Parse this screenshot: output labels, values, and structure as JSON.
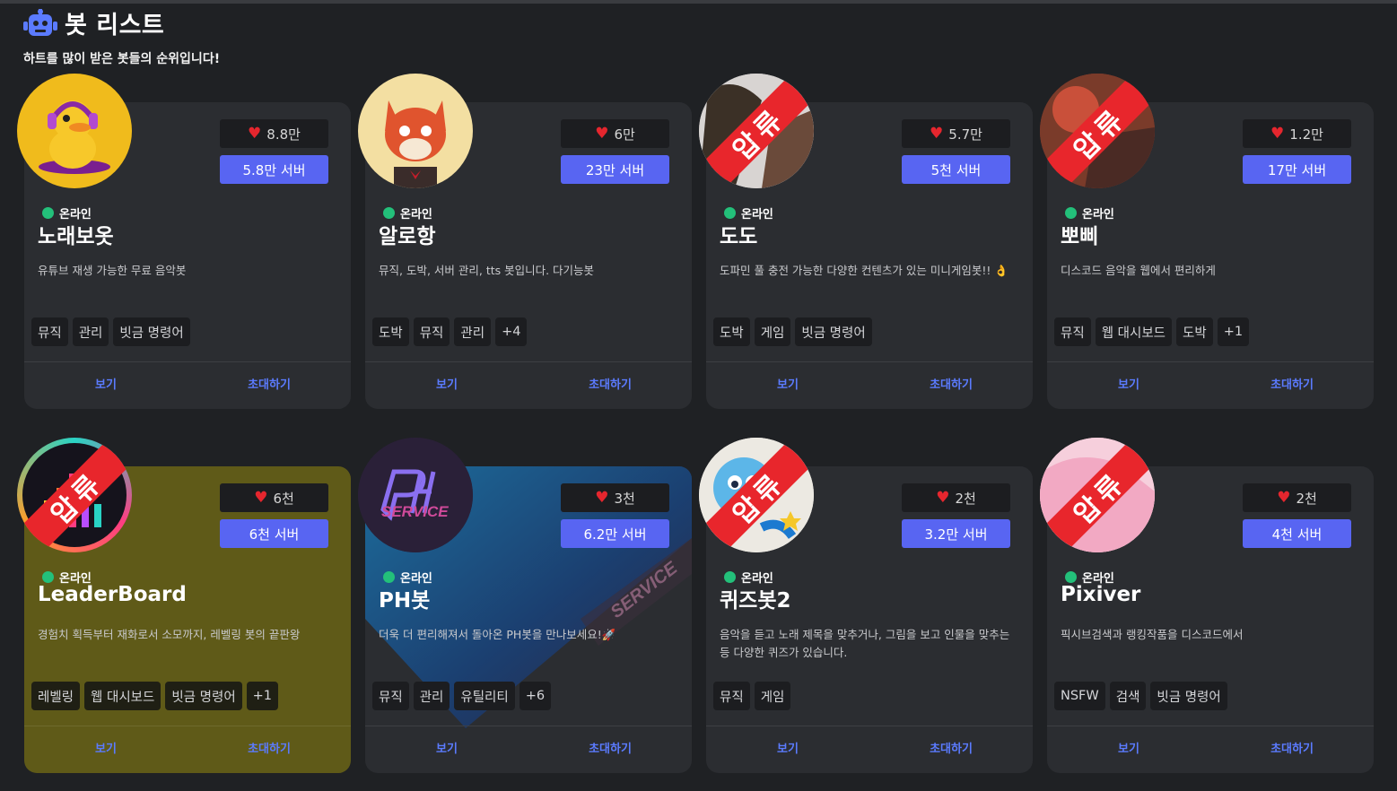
{
  "header": {
    "title": "봇 리스트",
    "subtitle": "하트를 많이 받은 봇들의 순위입니다!",
    "icon": "robot-icon"
  },
  "status_label": "온라인",
  "actions": {
    "view": "보기",
    "invite": "초대하기"
  },
  "ribbon_text": "압류",
  "colors": {
    "accent": "#5865f2",
    "heart": "#e5262e",
    "online": "#23c07a",
    "link": "#5b7bff"
  },
  "bots": [
    {
      "name": "노래보옷",
      "hearts": "8.8만",
      "servers": "5.8만 서버",
      "description": "유튜브 재생 가능한 무료 음악봇",
      "tags": [
        "뮤직",
        "관리",
        "빗금 명령어"
      ],
      "seized": false,
      "theme": "default"
    },
    {
      "name": "알로항",
      "hearts": "6만",
      "servers": "23만 서버",
      "description": "뮤직, 도박, 서버 관리, tts 봇입니다. 다기능봇",
      "tags": [
        "도박",
        "뮤직",
        "관리",
        "+4"
      ],
      "seized": false,
      "theme": "default"
    },
    {
      "name": "도도",
      "hearts": "5.7만",
      "servers": "5천 서버",
      "description": "도파민 풀 충전 가능한 다양한 컨텐츠가 있는 미니게임봇!! 👌",
      "tags": [
        "도박",
        "게임",
        "빗금 명령어"
      ],
      "seized": true,
      "theme": "default"
    },
    {
      "name": "뽀삐",
      "hearts": "1.2만",
      "servers": "17만 서버",
      "description": "디스코드 음악을 웹에서 편리하게",
      "tags": [
        "뮤직",
        "웹 대시보드",
        "도박",
        "+1"
      ],
      "seized": true,
      "theme": "default"
    },
    {
      "name": "LeaderBoard",
      "hearts": "6천",
      "servers": "6천 서버",
      "description": "경험치 획득부터 재화로서 소모까지, 레벨링 봇의 끝판왕",
      "tags": [
        "레벨링",
        "웹 대시보드",
        "빗금 명령어",
        "+1"
      ],
      "seized": true,
      "theme": "yellow"
    },
    {
      "name": "PH봇",
      "hearts": "3천",
      "servers": "6.2만 서버",
      "description": "더욱 더 편리해져서 돌아온 PH봇을 만나보세요!🚀",
      "tags": [
        "뮤직",
        "관리",
        "유틸리티",
        "+6"
      ],
      "seized": false,
      "theme": "gradient",
      "avatar_text": "SERVICE",
      "watermark_text": "SERVICE"
    },
    {
      "name": "퀴즈봇2",
      "hearts": "2천",
      "servers": "3.2만 서버",
      "description": "음악을 듣고 노래 제목을 맞추거나, 그림을 보고 인물을 맞추는 등 다양한 퀴즈가 있습니다.",
      "tags": [
        "뮤직",
        "게임"
      ],
      "seized": true,
      "theme": "default"
    },
    {
      "name": "Pixiver",
      "hearts": "2천",
      "servers": "4천 서버",
      "description": "픽시브검색과 랭킹작품을 디스코드에서",
      "tags": [
        "NSFW",
        "검색",
        "빗금 명령어"
      ],
      "seized": true,
      "theme": "default"
    }
  ]
}
